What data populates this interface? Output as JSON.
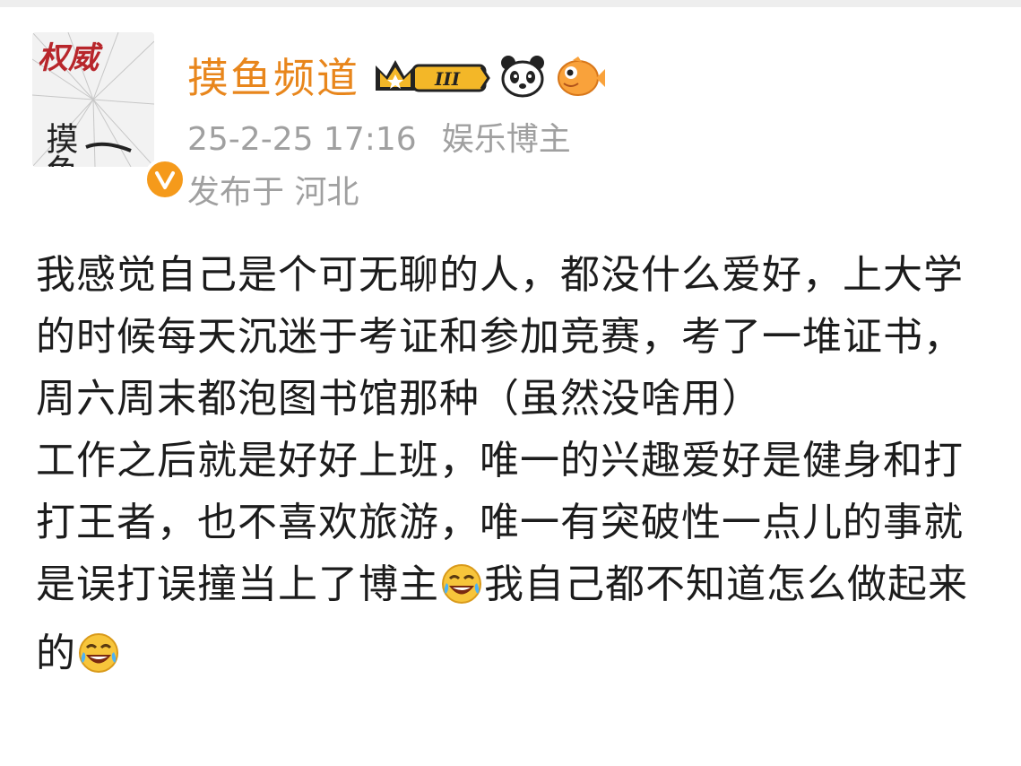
{
  "post": {
    "author": {
      "name": "摸鱼频道",
      "avatar_text": [
        "权威",
        "摸鱼"
      ],
      "verified": true,
      "badges": [
        "crown-level-badge",
        "panda-emoji-badge",
        "fish-emoji-badge"
      ],
      "level": "III"
    },
    "meta": {
      "timestamp": "25-2-25 17:16",
      "category": "娱乐博主",
      "location_prefix": "发布于",
      "location": "河北"
    },
    "body": {
      "p1": "我感觉自己是个可无聊的人，都没什么爱好，上大学的时候每天沉迷于考证和参加竞赛，考了一堆证书，周六周末都泡图书馆那种（虽然没啥用）",
      "p2_a": "工作之后就是好好上班，唯一的兴趣爱好是健身和打打王者，也不喜欢旅游，唯一有突破性一点儿的事就是误打误撞当上了博主",
      "p2_b": "我自己都不知道怎么做起来的"
    }
  },
  "colors": {
    "username": "#e8861c",
    "meta": "#a0a0a0",
    "verified": "#f59a1b",
    "text": "#1c1c1c"
  }
}
